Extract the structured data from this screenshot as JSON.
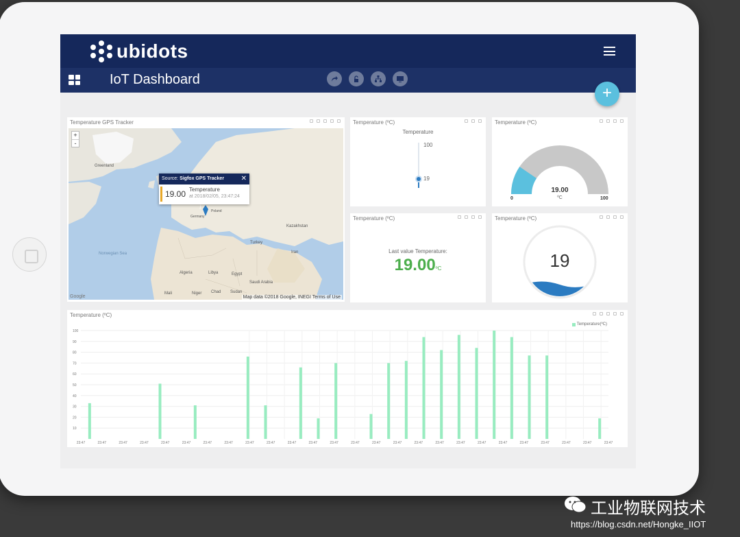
{
  "app": {
    "logo": "ubidots",
    "dashboard_title": "IoT Dashboard"
  },
  "toolbar_icons": [
    "share-icon",
    "lock-icon",
    "hierarchy-icon",
    "monitor-icon"
  ],
  "map_widget": {
    "title": "Temperature GPS Tracker",
    "zoom_in": "+",
    "zoom_out": "-",
    "popup": {
      "source_prefix": "Source: ",
      "source_name": "Sigfox GPS Tracker",
      "close": "✕",
      "value": "19.00",
      "label": "Temperature",
      "time": "at 2018/02/05, 23:47:24"
    },
    "attribution": "Map data ©2018 Google, INEGI   Terms of Use",
    "google": "Google",
    "places": [
      "Greenland",
      "Norwegian Sea",
      "Kazakhstan",
      "Germany",
      "Poland",
      "Algeria",
      "Libya",
      "Egypt",
      "Saudi Arabia",
      "Mali",
      "Niger",
      "Chad",
      "Sudan",
      "Turkey",
      "Iran"
    ]
  },
  "thermometer_widget": {
    "title": "Temperature (ºC)",
    "caption": "Temperature",
    "max": "100",
    "value": "19",
    "level": 19
  },
  "gauge_widget": {
    "title": "Temperature (ºC)",
    "value": "19.00",
    "unit": "ºC",
    "min": "0",
    "max": "100",
    "level": 19
  },
  "last_value_widget": {
    "title": "Temperature (ºC)",
    "caption": "Last value Temperature:",
    "value": "19.00",
    "unit": "ºC"
  },
  "tank_widget": {
    "title": "Temperature (ºC)",
    "value": "19",
    "level": 19
  },
  "bar_widget": {
    "title": "Temperature (ºC)",
    "legend": "Temperature(ºC)"
  },
  "accent_colors": {
    "navy": "#15285b",
    "cyan": "#5bc0de",
    "green": "#5cb85c",
    "bar": "#98ecc0",
    "blue": "#2b7bc1"
  },
  "chart_data": {
    "type": "bar",
    "title": "",
    "xlabel": "",
    "ylabel": "",
    "ylim": [
      0,
      100
    ],
    "yticks": [
      10,
      20,
      30,
      40,
      50,
      60,
      70,
      80,
      90,
      100
    ],
    "categories": [
      "23:47",
      "23:47",
      "23:47",
      "23:47",
      "23:47",
      "23:47",
      "23:47",
      "23:47",
      "23:47",
      "23:47",
      "23:47",
      "23:47",
      "23:47",
      "23:47",
      "23:47",
      "23:47",
      "23:47",
      "23:47",
      "23:47",
      "23:47",
      "23:47",
      "23:47",
      "23:47",
      "23:47",
      "23:47",
      "23:47"
    ],
    "series": [
      {
        "name": "Temperature(ºC)",
        "values": [
          33,
          0,
          0,
          0,
          51,
          0,
          31,
          0,
          0,
          76,
          31,
          0,
          66,
          19,
          70,
          0,
          23,
          70,
          72,
          94,
          82,
          96,
          84,
          100,
          94,
          77,
          77,
          0,
          0,
          19
        ]
      }
    ],
    "grid": true,
    "legend": "top-right"
  },
  "watermark": {
    "title": "工业物联网技术",
    "url": "https://blog.csdn.net/Hongke_IIOT"
  }
}
